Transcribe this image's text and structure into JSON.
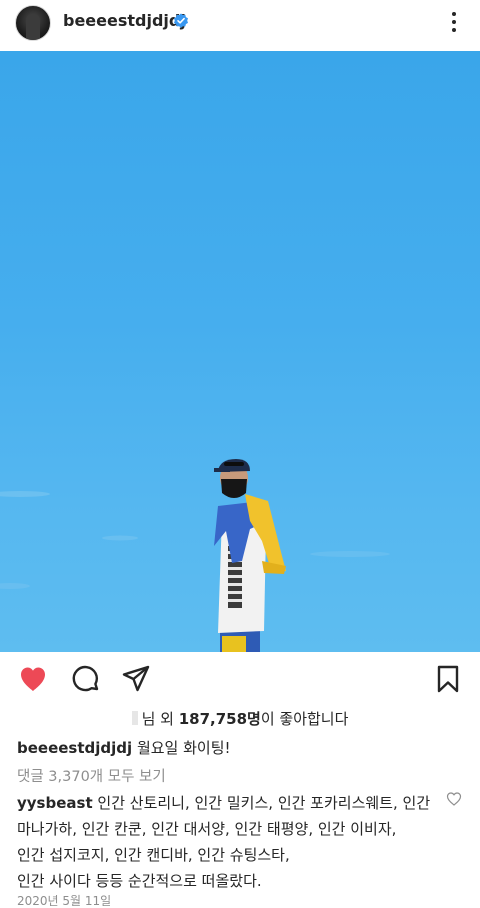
{
  "header": {
    "username": "beeeestdjdjdj",
    "icons": {
      "avatar": "profile-avatar",
      "verified": "verified-badge-icon",
      "more": "more-vertical-icon"
    },
    "verified_color": "#3897f0"
  },
  "post": {
    "image_subject": "photo"
  },
  "actions": {
    "icons": [
      "heart-icon-filled",
      "comment-icon",
      "share-icon",
      "bookmark-icon"
    ],
    "like_color": "#ed4956"
  },
  "likes": {
    "prefix": "님 외 ",
    "count": "187,758명",
    "suffix": "이 좋아합니다"
  },
  "caption": {
    "username": "beeeestdjdjdj",
    "text": "월요일 화이팅!"
  },
  "comments": {
    "view_all": "댓글 3,370개 모두 보기"
  },
  "top_comment": {
    "username": "yysbeast",
    "lines": [
      "인간 산토리니, 인간 밀키스, 인간 포카리스웨트, 인간",
      "마나가하, 인간 칸쿤, 인간 대서양, 인간 태평양, 인간 이비자,",
      "인간 섭지코지, 인간 캔디바, 인간 슈팅스타,",
      "인간 사이다 등등 순간적으로 떠올랐다."
    ]
  },
  "date": "2020년 5월 11일"
}
